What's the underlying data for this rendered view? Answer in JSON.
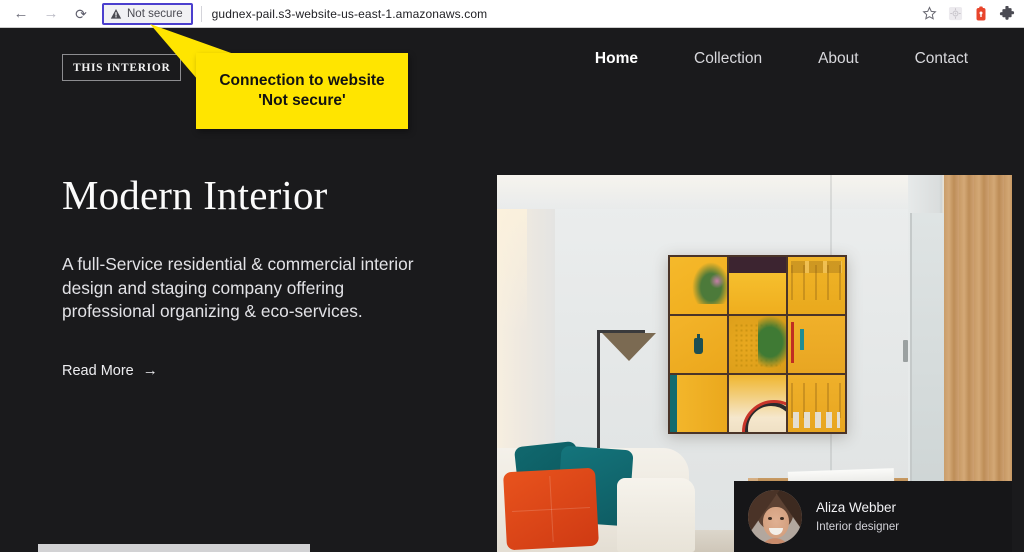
{
  "browser": {
    "back_icon": "arrow-left-icon",
    "forward_icon": "arrow-right-icon",
    "reload_icon": "reload-icon",
    "security_label": "Not secure",
    "security_icon": "warning-triangle-icon",
    "url": "gudnex-pail.s3-website-us-east-1.amazonaws.com",
    "bookmark_icon": "star-icon",
    "extensions": [
      "settings-gear-icon",
      "lastpass-icon",
      "puzzle-piece-icon"
    ],
    "highlight_color": "#4b3fce"
  },
  "callout": {
    "text": "Connection to website 'Not secure'",
    "background": "#ffe500",
    "text_color": "#121212"
  },
  "site": {
    "logo": "THIS INTERIOR",
    "background": "#1a1a1c",
    "nav": [
      {
        "label": "Home",
        "active": true
      },
      {
        "label": "Collection",
        "active": false
      },
      {
        "label": "About",
        "active": false
      },
      {
        "label": "Contact",
        "active": false
      }
    ]
  },
  "hero": {
    "title": "Modern Interior",
    "description": "A full-Service residential & commercial interior design and staging company offering professional organizing & eco-services.",
    "cta_label": "Read More",
    "cta_arrow": "→",
    "image_alt": "modern-living-room-photo"
  },
  "designer_card": {
    "name": "Aliza Webber",
    "role": "Interior designer",
    "avatar": "designer-portrait-avatar"
  }
}
